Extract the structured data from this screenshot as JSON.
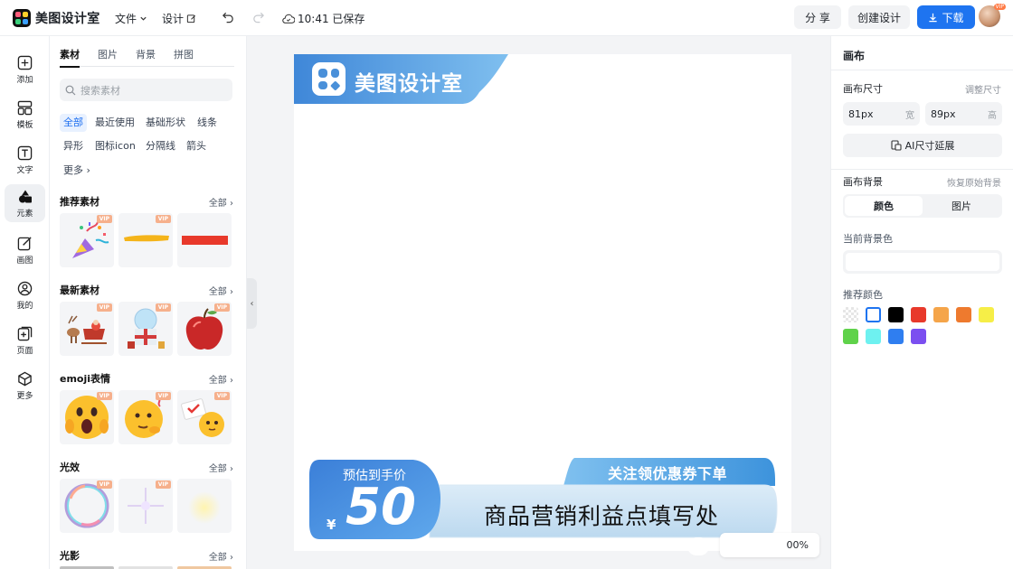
{
  "header": {
    "app_name": "美图设计室",
    "menu_file": "文件",
    "menu_design": "设计",
    "save_status": "10:41 已保存",
    "share_label": "分 享",
    "create_label": "创建设计",
    "download_label": "下载",
    "avatar_badge": "VIP"
  },
  "rail": [
    {
      "label": "添加",
      "icon": "plus-square-icon"
    },
    {
      "label": "模板",
      "icon": "layout-icon"
    },
    {
      "label": "文字",
      "icon": "text-icon"
    },
    {
      "label": "元素",
      "icon": "shapes-icon"
    },
    {
      "label": "画图",
      "icon": "edit-icon"
    },
    {
      "label": "我的",
      "icon": "user-icon"
    },
    {
      "label": "页面",
      "icon": "page-add-icon"
    },
    {
      "label": "更多",
      "icon": "cube-icon"
    }
  ],
  "panel": {
    "tabs": [
      "素材",
      "图片",
      "背景",
      "拼图"
    ],
    "search_placeholder": "搜索素材",
    "chips": [
      "全部",
      "最近使用",
      "基础形状",
      "线条",
      "异形",
      "图标icon",
      "分隔线",
      "箭头",
      "更多"
    ],
    "sections": [
      {
        "title": "推荐素材",
        "all": "全部"
      },
      {
        "title": "最新素材",
        "all": "全部"
      },
      {
        "title": "emoji表情",
        "all": "全部"
      },
      {
        "title": "光效",
        "all": "全部"
      },
      {
        "title": "光影",
        "all": "全部"
      }
    ],
    "vip_badge": "VIP"
  },
  "canvas": {
    "brand_text": "美图设计室",
    "price_label": "预估到手价",
    "price_currency": "¥",
    "price_value": "50",
    "follow_text": "关注领优惠券下单",
    "benefit_text": "商品营销利益点填写处",
    "zoom": "00%"
  },
  "right": {
    "title": "画布",
    "size_label": "画布尺寸",
    "size_link": "调整尺寸",
    "width_value": "81px",
    "width_unit": "宽",
    "height_value": "89px",
    "height_unit": "高",
    "ai_extend": "AI尺寸延展",
    "bg_label": "画布背景",
    "bg_reset": "恢复原始背景",
    "seg_color": "颜色",
    "seg_image": "图片",
    "current_bg": "当前背景色",
    "recommend": "推荐颜色",
    "colors": [
      "transparent",
      "#ffffff",
      "#000000",
      "#e8392b",
      "#f5a54a",
      "#ee7a2e",
      "#f6ee47",
      "#5fd24a",
      "#6ef1f0",
      "#2f7ef0",
      "#7b4ff0"
    ]
  }
}
